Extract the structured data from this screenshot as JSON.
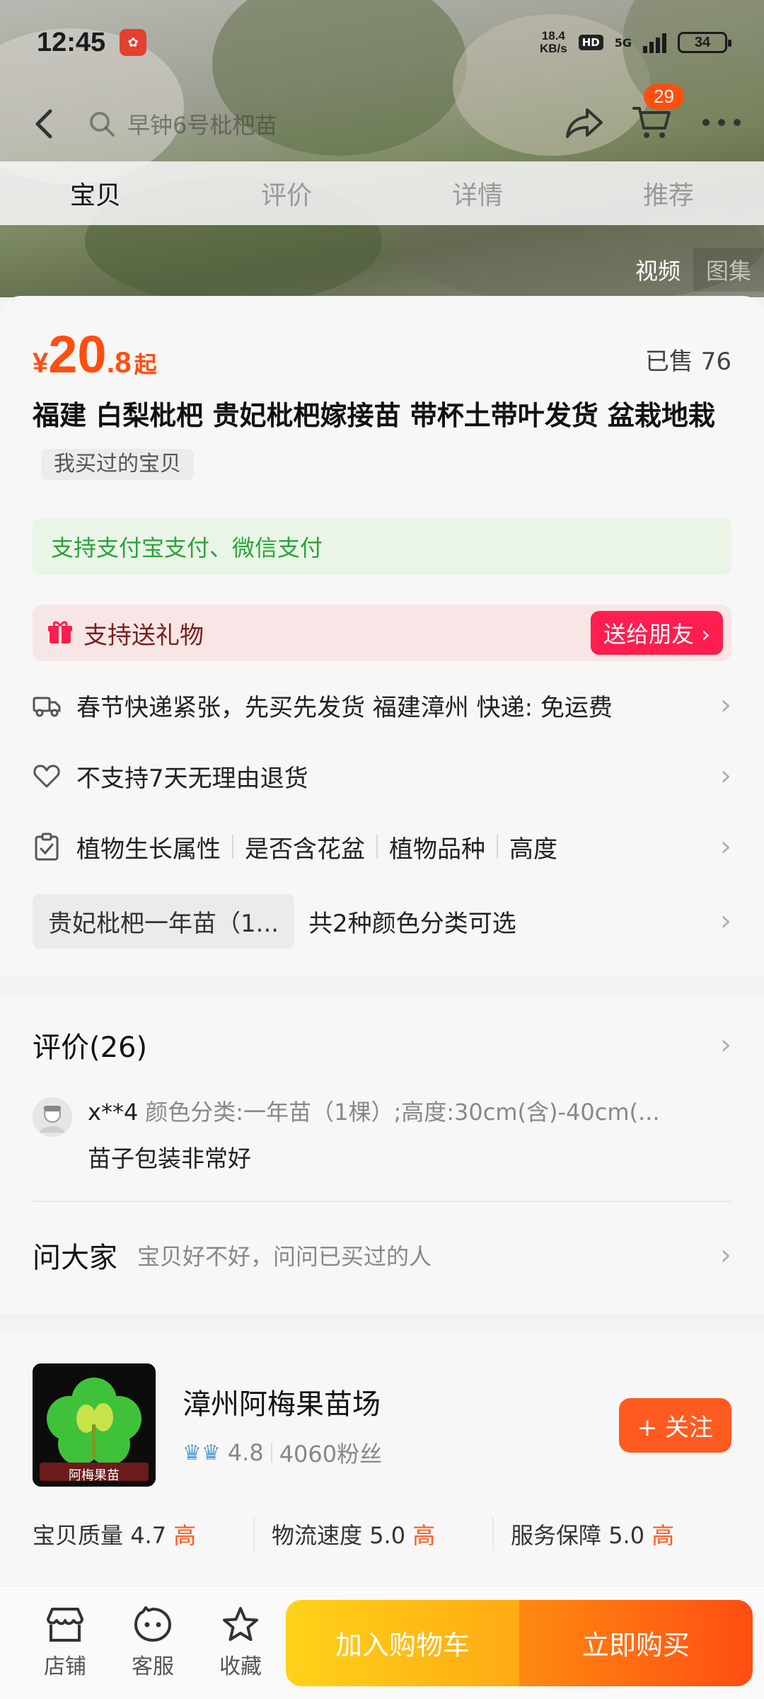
{
  "status_bar": {
    "time": "12:45",
    "speed_value": "18.4",
    "speed_unit": "KB/s",
    "hd": "HD",
    "network": "5G",
    "battery": "34"
  },
  "header": {
    "search_placeholder": "早钟6号枇杷苗",
    "cart_count": "29",
    "tabs": [
      "宝贝",
      "评价",
      "详情",
      "推荐"
    ],
    "media_switch": [
      "视频",
      "图集"
    ]
  },
  "product": {
    "price_currency": "¥",
    "price_int": "20",
    "price_dec": ".8",
    "price_suffix": "起",
    "sold": "已售 76",
    "title": "福建 白梨枇杷 贵妃枇杷嫁接苗 带杯土带叶发货 盆栽地栽",
    "bought_tag": "我买过的宝贝",
    "payment_note": "支持支付宝支付、微信支付",
    "gift_label": "支持送礼物",
    "gift_button": "送给朋友 ›"
  },
  "info_rows": {
    "shipping": "春节快递紧张，先买先发货  福建漳州  快递: 免运费",
    "return_policy": "不支持7天无理由退货",
    "attributes": [
      "植物生长属性",
      "是否含花盆",
      "植物品种",
      "高度"
    ],
    "sku_chip": "贵妃枇杷一年苗（1...",
    "sku_note": "共2种颜色分类可选"
  },
  "reviews": {
    "header": "评价(26)",
    "items": [
      {
        "user": "x**4",
        "sku": "颜色分类:一年苗（1棵）;高度:30cm(含)-40cm(...",
        "text": "苗子包装非常好"
      }
    ],
    "ask_title": "问大家",
    "ask_sub": "宝贝好不好，问问已买过的人"
  },
  "shop": {
    "name": "漳州阿梅果苗场",
    "logo_text": "阿梅果苗",
    "rating": "4.8",
    "fans": "4060粉丝",
    "follow": "+ 关注",
    "scores": [
      {
        "label": "宝贝质量",
        "value": "4.7",
        "level": "高"
      },
      {
        "label": "物流速度",
        "value": "5.0",
        "level": "高"
      },
      {
        "label": "服务保障",
        "value": "5.0",
        "level": "高"
      }
    ]
  },
  "bottom_bar": {
    "nav": [
      "店铺",
      "客服",
      "收藏"
    ],
    "add_to_cart": "加入购物车",
    "buy_now": "立即购买"
  },
  "colors": {
    "price": "#ff4e0e",
    "gift_button": "#ff1e4d",
    "pay_green": "#2aa33a"
  }
}
